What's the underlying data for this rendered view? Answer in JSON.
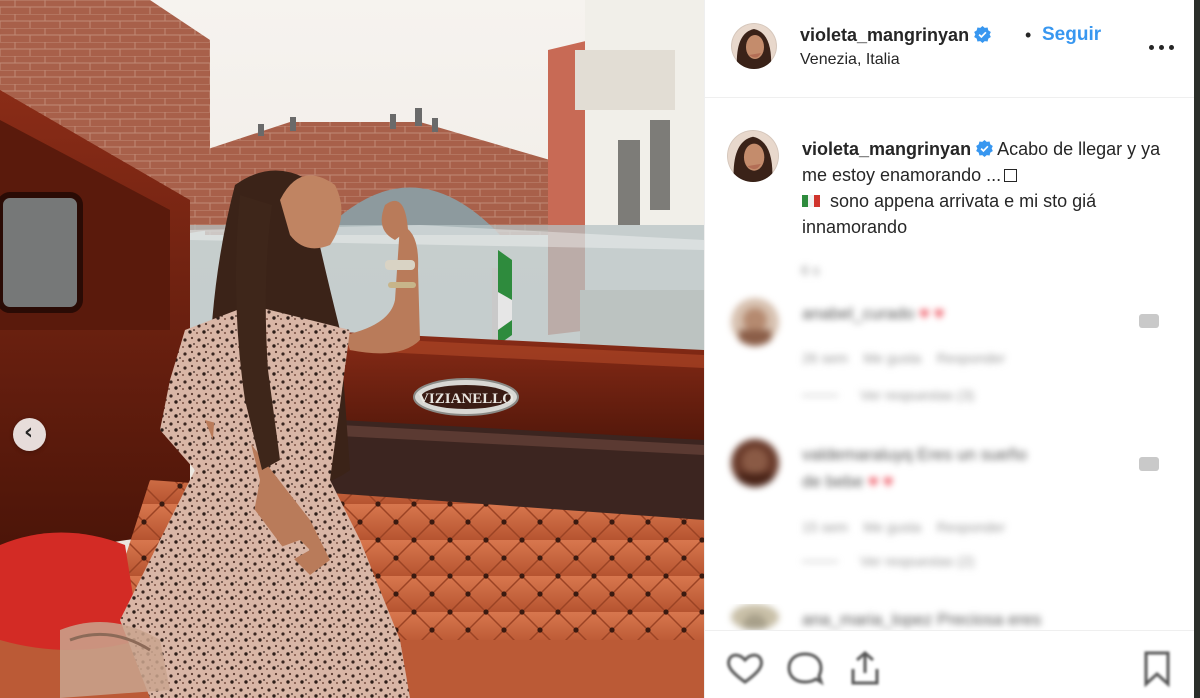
{
  "post": {
    "username": "violeta_mangrinyan",
    "follow_label": "Seguir",
    "dot": "•",
    "location": "Venezia, Italia",
    "boat_brand": "VIZIANELLO",
    "caption": {
      "line1": "Acabo de llegar y ya me estoy enamorando ...",
      "line2": "sono appena arrivata e mi sto giá innamorando"
    }
  },
  "comments": [
    {
      "time_stub": "6 s",
      "author": "anabel_curado",
      "meta_time": "26 sem",
      "meta_likes": "Me gusta",
      "meta_reply": "Responder",
      "replies": "Ver respuestas (3)"
    },
    {
      "author": "valdemaraluyq",
      "text_a": "Eres un sueño",
      "text_b": "de bebe",
      "meta_time": "15 sem",
      "meta_likes": "Me gusta",
      "meta_reply": "Responder",
      "replies": "Ver respuestas (2)"
    },
    {
      "author": "ana_maria_lopez",
      "text_a": "Preciosa eres"
    }
  ],
  "colors": {
    "accent": "#3897f0",
    "text": "#262626",
    "border": "#efefef",
    "like_red": "#ed4956"
  },
  "icons": [
    "verified-badge-icon",
    "more-options-icon",
    "chevron-left-icon",
    "heart-icon",
    "comment-icon",
    "share-icon",
    "bookmark-icon"
  ]
}
